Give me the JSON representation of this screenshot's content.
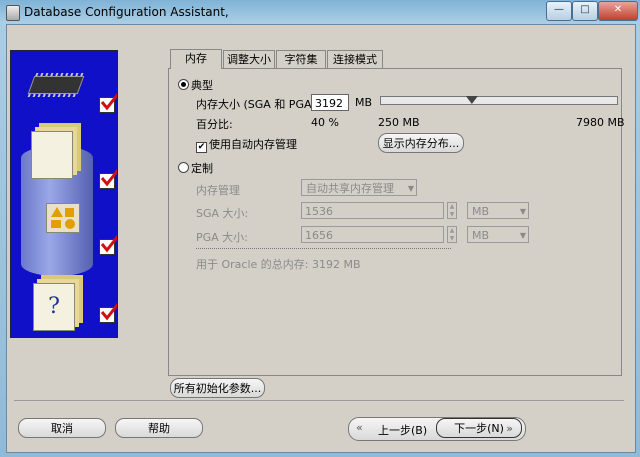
{
  "window": {
    "title": "Database Configuration Assistant,",
    "controls": {
      "minimize": "—",
      "maximize": "□",
      "close": "✕"
    }
  },
  "tabs": [
    {
      "label": "内存",
      "active": true
    },
    {
      "label": "调整大小",
      "active": false
    },
    {
      "label": "字符集",
      "active": false
    },
    {
      "label": "连接模式",
      "active": false
    }
  ],
  "typical": {
    "radio_label": "典型",
    "selected": true,
    "memory_size_label": "内存大小 (SGA 和 PGA):",
    "memory_size_value": "3192",
    "memory_unit": "MB",
    "percent_label": "百分比:",
    "percent_value": "40 %",
    "slider_min_label": "250 MB",
    "slider_max_label": "7980 MB",
    "slider_fraction": 0.38,
    "auto_memory_label": "使用自动内存管理",
    "auto_memory_checked": true,
    "show_distribution_button": "显示内存分布..."
  },
  "custom": {
    "radio_label": "定制",
    "selected": false,
    "memory_mgmt_label": "内存管理",
    "memory_mgmt_value": "自动共享内存管理",
    "sga_label": "SGA 大小:",
    "sga_value": "1536",
    "sga_unit": "MB",
    "pga_label": "PGA 大小:",
    "pga_value": "1656",
    "pga_unit": "MB",
    "total_text": "用于 Oracle 的总内存:  3192 MB"
  },
  "all_init_params_button": "所有初始化参数...",
  "footer": {
    "cancel": "取消",
    "help": "帮助",
    "back": "上一步(B)",
    "next": "下一步(N)"
  },
  "colors": {
    "left_panel": "#1010c8",
    "check_red": "#d01010",
    "dialog_bg": "#d4d0c8"
  },
  "steps_icons": [
    "chip-icon",
    "documents-icon",
    "shapes-icon",
    "help-docs-icon"
  ]
}
